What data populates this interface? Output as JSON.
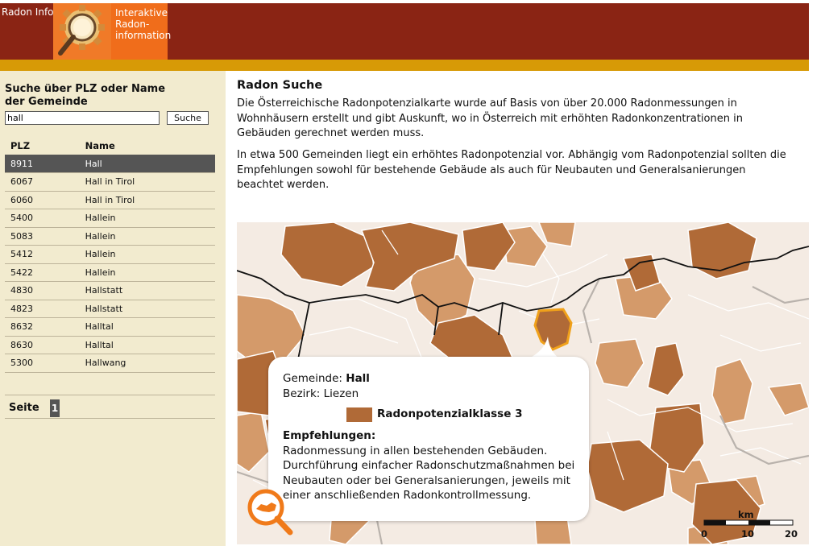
{
  "header": {
    "brand": "Radon Info",
    "logo_text": "Interaktive\nRadon-\ninformation",
    "logo_icon": "magnifier-gear-icon"
  },
  "sidebar": {
    "search_heading": "Suche über PLZ oder Name der Gemeinde",
    "search_value": "hall",
    "search_button": "Suche",
    "columns": {
      "plz": "PLZ",
      "name": "Name"
    },
    "results": [
      {
        "plz": "8911",
        "name": "Hall"
      },
      {
        "plz": "6067",
        "name": "Hall in Tirol"
      },
      {
        "plz": "6060",
        "name": "Hall in Tirol"
      },
      {
        "plz": "5400",
        "name": "Hallein"
      },
      {
        "plz": "5083",
        "name": "Hallein"
      },
      {
        "plz": "5412",
        "name": "Hallein"
      },
      {
        "plz": "5422",
        "name": "Hallein"
      },
      {
        "plz": "4830",
        "name": "Hallstatt"
      },
      {
        "plz": "4823",
        "name": "Hallstatt"
      },
      {
        "plz": "8632",
        "name": "Halltal"
      },
      {
        "plz": "8630",
        "name": "Halltal"
      },
      {
        "plz": "5300",
        "name": "Hallwang"
      }
    ],
    "selected_index": 0,
    "pager_label": "Seite",
    "pager_page": "1"
  },
  "main": {
    "title": "Radon Suche",
    "paragraph1": "Die Österreichische Radonpotenzialkarte wurde auf Basis von über 20.000 Radonmessungen in Wohnhäusern erstellt und gibt Auskunft, wo in Österreich mit erhöhten Radonkonzentrationen in Gebäuden gerechnet werden muss.",
    "paragraph2": "In etwa 500 Gemeinden liegt ein erhöhtes Radonpotenzial vor. Abhängig vom Radonpotenzial sollten die Empfehlungen sowohl für bestehende Gebäude als auch für Neubauten und Generalsanierungen beachtet werden."
  },
  "popup": {
    "gemeinde_label": "Gemeinde:",
    "gemeinde_value": "Hall",
    "bezirk_label": "Bezirk:",
    "bezirk_value": "Liezen",
    "class_label": "Radonpotenzialklasse 3",
    "reco_heading": "Empfehlungen:",
    "reco_text": "Radonmessung in allen bestehenden Gebäuden.\nDurchführung einfacher Radonschutzmaßnahmen bei Neubauten oder bei Generalsanierungen, jeweils mit einer anschließenden Radonkontrollmessung."
  },
  "scale": {
    "unit": "km",
    "labels": [
      "0",
      "10",
      "20"
    ]
  },
  "colors": {
    "header": "#8a2414",
    "gold": "#d79a06",
    "logo": "#f06d1b",
    "sidebar": "#f2ebcf",
    "class1": "#f4ebe3",
    "class2": "#d49a6a",
    "class3": "#b06a37",
    "highlight": "#f0a11a"
  },
  "icons": {
    "zoom": "zoom-austria-icon"
  }
}
